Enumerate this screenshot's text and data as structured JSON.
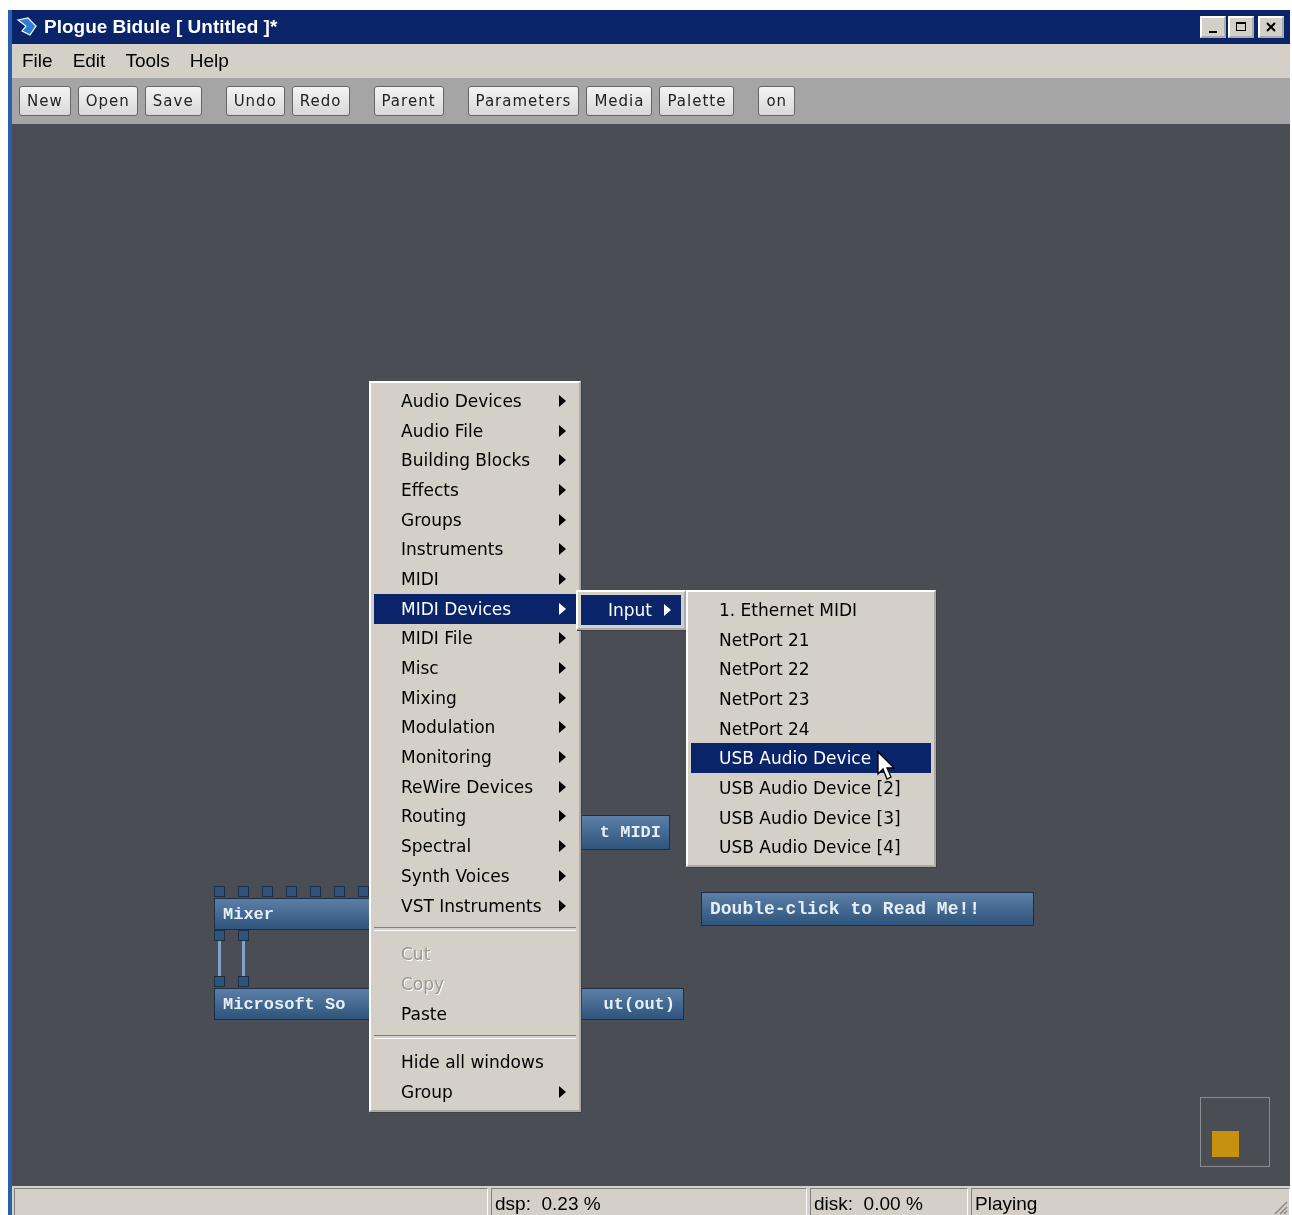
{
  "window": {
    "title": "Plogue Bidule [ Untitled ]*"
  },
  "menu_bar": [
    "File",
    "Edit",
    "Tools",
    "Help"
  ],
  "toolbar": {
    "groups": [
      [
        "New",
        "Open",
        "Save"
      ],
      [
        "Undo",
        "Redo"
      ],
      [
        "Parent"
      ],
      [
        "Parameters",
        "Media",
        "Palette"
      ],
      [
        "on"
      ]
    ]
  },
  "canvas": {
    "midi_node_text": "t MIDI",
    "mixer_node_text": "Mixer",
    "device_node_texts": [
      "Microsoft So",
      "ut(out)"
    ],
    "readme_node_text": "Double-click to Read Me!!"
  },
  "context_menu": {
    "items": [
      {
        "kind": "item",
        "label": "Audio Devices",
        "submenu": true,
        "selected": false,
        "disabled": false
      },
      {
        "kind": "item",
        "label": "Audio File",
        "submenu": true,
        "selected": false,
        "disabled": false
      },
      {
        "kind": "item",
        "label": "Building Blocks",
        "submenu": true,
        "selected": false,
        "disabled": false
      },
      {
        "kind": "item",
        "label": "Effects",
        "submenu": true,
        "selected": false,
        "disabled": false
      },
      {
        "kind": "item",
        "label": "Groups",
        "submenu": true,
        "selected": false,
        "disabled": false
      },
      {
        "kind": "item",
        "label": "Instruments",
        "submenu": true,
        "selected": false,
        "disabled": false
      },
      {
        "kind": "item",
        "label": "MIDI",
        "submenu": true,
        "selected": false,
        "disabled": false
      },
      {
        "kind": "item",
        "label": "MIDI Devices",
        "submenu": true,
        "selected": true,
        "disabled": false
      },
      {
        "kind": "item",
        "label": "MIDI File",
        "submenu": true,
        "selected": false,
        "disabled": false
      },
      {
        "kind": "item",
        "label": "Misc",
        "submenu": true,
        "selected": false,
        "disabled": false
      },
      {
        "kind": "item",
        "label": "Mixing",
        "submenu": true,
        "selected": false,
        "disabled": false
      },
      {
        "kind": "item",
        "label": "Modulation",
        "submenu": true,
        "selected": false,
        "disabled": false
      },
      {
        "kind": "item",
        "label": "Monitoring",
        "submenu": true,
        "selected": false,
        "disabled": false
      },
      {
        "kind": "item",
        "label": "ReWire Devices",
        "submenu": true,
        "selected": false,
        "disabled": false
      },
      {
        "kind": "item",
        "label": "Routing",
        "submenu": true,
        "selected": false,
        "disabled": false
      },
      {
        "kind": "item",
        "label": "Spectral",
        "submenu": true,
        "selected": false,
        "disabled": false
      },
      {
        "kind": "item",
        "label": "Synth Voices",
        "submenu": true,
        "selected": false,
        "disabled": false
      },
      {
        "kind": "item",
        "label": "VST Instruments",
        "submenu": true,
        "selected": false,
        "disabled": false
      },
      {
        "kind": "separator"
      },
      {
        "kind": "item",
        "label": "Cut",
        "submenu": false,
        "selected": false,
        "disabled": true
      },
      {
        "kind": "item",
        "label": "Copy",
        "submenu": false,
        "selected": false,
        "disabled": true
      },
      {
        "kind": "item",
        "label": "Paste",
        "submenu": false,
        "selected": false,
        "disabled": false
      },
      {
        "kind": "separator"
      },
      {
        "kind": "item",
        "label": "Hide all windows",
        "submenu": false,
        "selected": false,
        "disabled": false
      },
      {
        "kind": "item",
        "label": "Group",
        "submenu": true,
        "selected": false,
        "disabled": false
      }
    ]
  },
  "submenu": {
    "items": [
      {
        "kind": "item",
        "label": "Input",
        "submenu": true,
        "selected": true,
        "disabled": false
      }
    ]
  },
  "device_menu": {
    "items": [
      {
        "kind": "item",
        "label": "1. Ethernet MIDI",
        "submenu": false,
        "selected": false,
        "disabled": false
      },
      {
        "kind": "item",
        "label": "NetPort 21",
        "submenu": false,
        "selected": false,
        "disabled": false
      },
      {
        "kind": "item",
        "label": "NetPort 22",
        "submenu": false,
        "selected": false,
        "disabled": false
      },
      {
        "kind": "item",
        "label": "NetPort 23",
        "submenu": false,
        "selected": false,
        "disabled": false
      },
      {
        "kind": "item",
        "label": "NetPort 24",
        "submenu": false,
        "selected": false,
        "disabled": false
      },
      {
        "kind": "item",
        "label": "USB Audio Device",
        "submenu": false,
        "selected": true,
        "disabled": false
      },
      {
        "kind": "item",
        "label": "USB Audio Device [2]",
        "submenu": false,
        "selected": false,
        "disabled": false
      },
      {
        "kind": "item",
        "label": "USB Audio Device [3]",
        "submenu": false,
        "selected": false,
        "disabled": false
      },
      {
        "kind": "item",
        "label": "USB Audio Device [4]",
        "submenu": false,
        "selected": false,
        "disabled": false
      }
    ]
  },
  "status_bar": [
    "dsp:  0.23 %",
    "disk:  0.00 %",
    "Playing"
  ]
}
